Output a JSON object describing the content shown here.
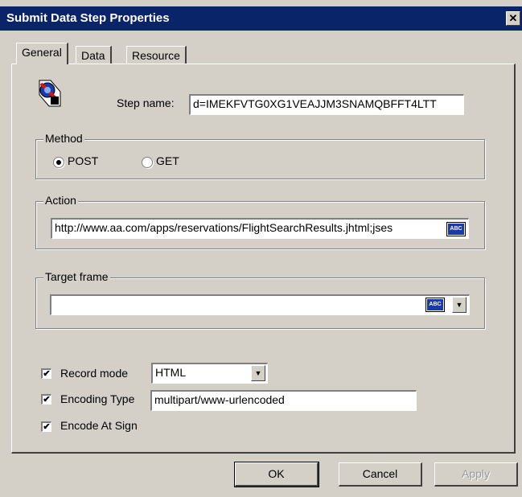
{
  "window": {
    "title": "Submit Data Step Properties",
    "close_symbol": "✕"
  },
  "tabs": [
    {
      "label": "General",
      "active": true
    },
    {
      "label": "Data",
      "active": false
    },
    {
      "label": "Resource",
      "active": false
    }
  ],
  "general": {
    "step_icon": "submit-data-step-icon",
    "step_name": {
      "label": "Step name:",
      "value": "d=IMEKFVTG0XG1VEAJJM3SNAMQBFFT4LTT"
    },
    "method": {
      "legend": "Method",
      "options": [
        {
          "label": "POST",
          "checked": true
        },
        {
          "label": "GET",
          "checked": false
        }
      ]
    },
    "action": {
      "legend": "Action",
      "value": "http://www.aa.com/apps/reservations/FlightSearchResults.jhtml;jses",
      "abc_label": "ABC"
    },
    "target_frame": {
      "legend": "Target frame",
      "value": "",
      "abc_label": "ABC",
      "arrow": "▼"
    },
    "record_mode": {
      "label": "Record mode",
      "checked": true,
      "value": "HTML",
      "arrow": "▼"
    },
    "encoding_type": {
      "label": "Encoding Type",
      "checked": true,
      "value": "multipart/www-urlencoded"
    },
    "encode_at_sign": {
      "label": "Encode At Sign",
      "checked": true
    },
    "check_mark": "✔"
  },
  "buttons": {
    "ok": "OK",
    "cancel": "Cancel",
    "apply": "Apply"
  },
  "colors": {
    "titlebar": "#0a246a",
    "face": "#d4d0c8",
    "abc_button": "#1a3aa8"
  }
}
